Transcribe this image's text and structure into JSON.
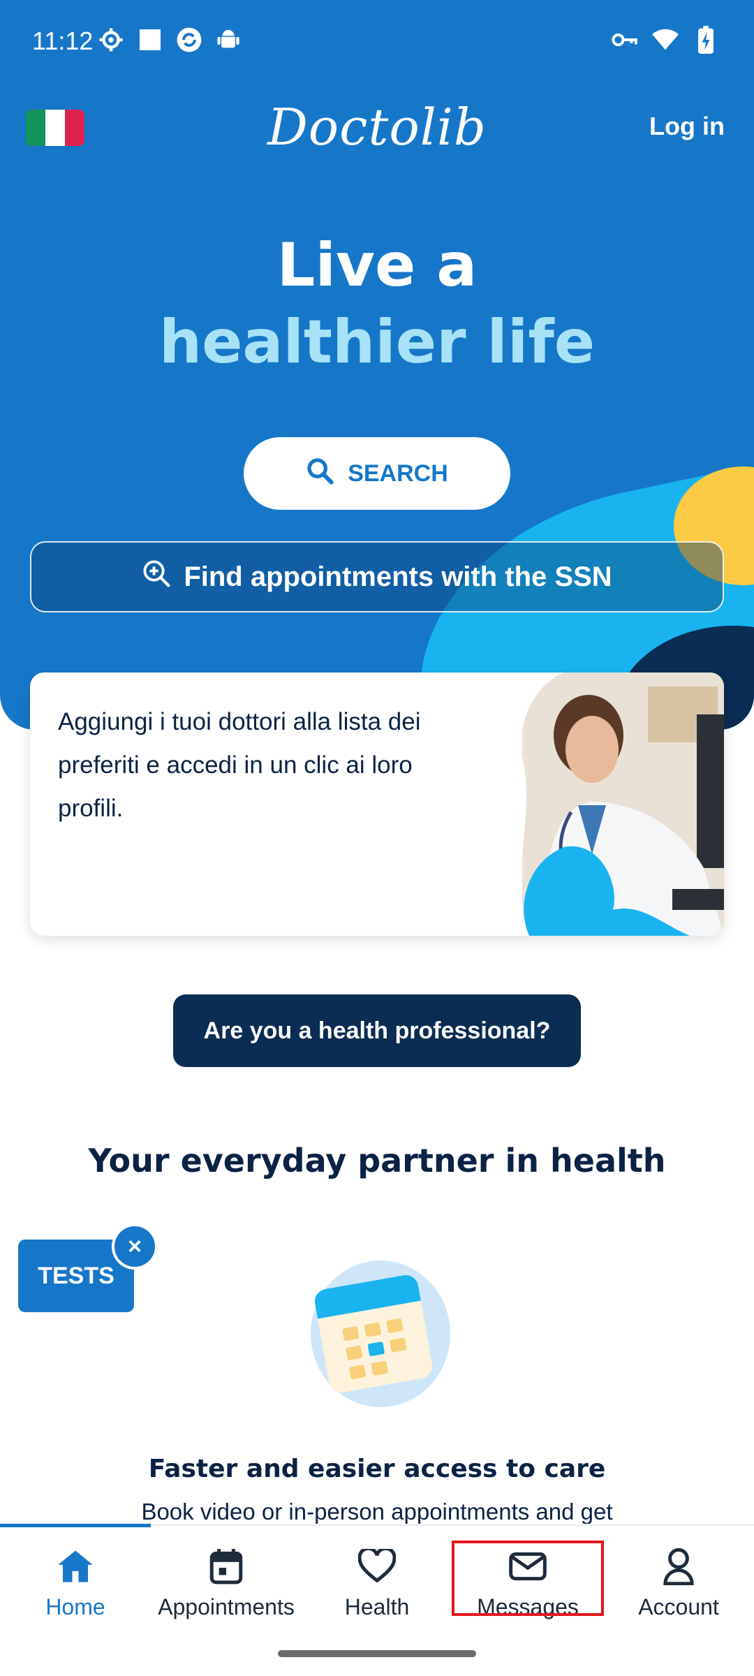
{
  "status_bar": {
    "time": "11:12",
    "left_icons": [
      "settings-gear-icon",
      "square-icon",
      "sync-icon",
      "android-icon"
    ],
    "right_icons": [
      "vpn-key-icon",
      "wifi-icon",
      "battery-charging-icon"
    ]
  },
  "header": {
    "logo": "Doctolib",
    "login_label": "Log in",
    "flag_colors": [
      "#14935a",
      "#ffffff",
      "#e0234c"
    ]
  },
  "hero": {
    "headline_line1": "Live a",
    "headline_line2": "healthier life",
    "search_label": "SEARCH",
    "ssn_label": "Find appointments with the SSN"
  },
  "promo_card": {
    "text": "Aggiungi i tuoi dottori alla lista dei preferiti e accedi in un clic ai loro profili."
  },
  "pro_button_label": "Are you a health professional?",
  "section": {
    "title": "Your everyday partner in health",
    "feature_title": "Faster and easier access to care",
    "feature_subtitle": "Book video or in-person appointments and get"
  },
  "tests_badge": {
    "label": "TESTS",
    "close": "×"
  },
  "bottom_nav": {
    "items": [
      {
        "label": "Home",
        "icon": "home-icon",
        "active": true
      },
      {
        "label": "Appointments",
        "icon": "calendar-icon",
        "active": false
      },
      {
        "label": "Health",
        "icon": "heart-icon",
        "active": false
      },
      {
        "label": "Messages",
        "icon": "envelope-icon",
        "active": false
      },
      {
        "label": "Account",
        "icon": "person-icon",
        "active": false
      }
    ]
  },
  "colors": {
    "brand_blue": "#1677c9",
    "navy": "#0b2c53",
    "cyan": "#19b4ef",
    "yellow": "#fbc943",
    "highlight_red": "#e3171f"
  }
}
